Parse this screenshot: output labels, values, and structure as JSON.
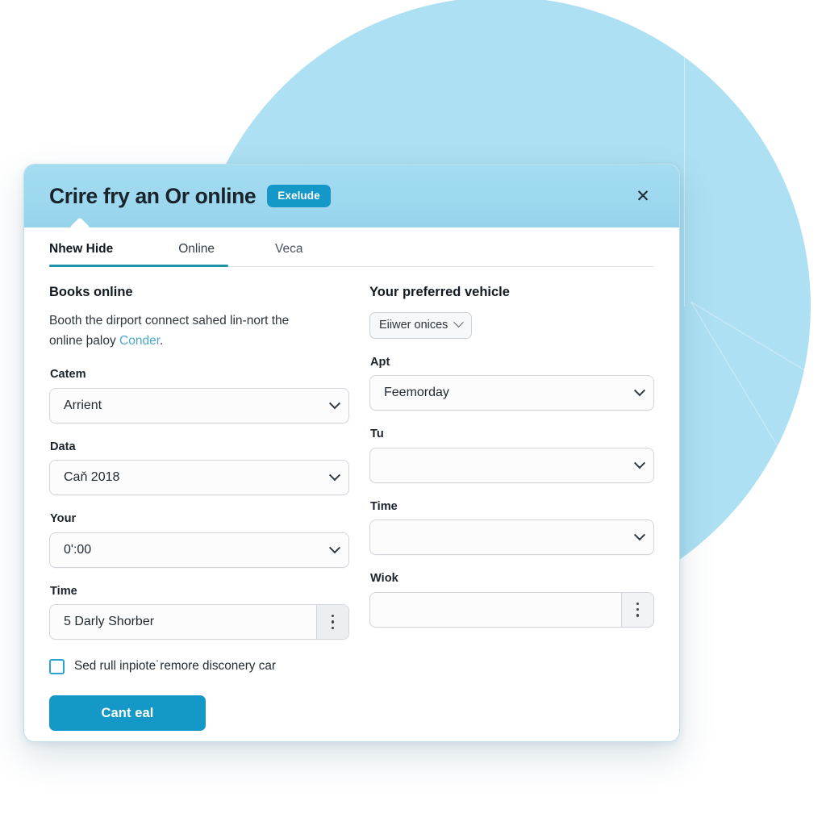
{
  "header": {
    "title": "Crire fry an Or online",
    "badge_label": "Exelude",
    "close_icon": "close-icon",
    "bg_color": "#9ed8ef",
    "badge_color": "#1398c8"
  },
  "tabs": [
    {
      "label": "Nhew Hide",
      "active": true
    },
    {
      "label": "Online",
      "active": false
    },
    {
      "label": "Veca",
      "active": false
    }
  ],
  "tabs_indicator_color": "#1f93a8",
  "left": {
    "section_title": "Books online",
    "paragraph_line1": "Booth the dirport connect sahed lin-nort",
    "paragraph_line2_prefix": "the online þaloу ",
    "paragraph_link": "Conder",
    "paragraph_suffix": ".",
    "fields": [
      {
        "label": "Catem",
        "value": "Arrient",
        "control": "select"
      },
      {
        "label": "Data",
        "value": "Caň 2018",
        "control": "select"
      },
      {
        "label": "Your",
        "value": "0':00",
        "control": "select"
      },
      {
        "label": "Time",
        "value": "5 Darly Shorber",
        "control": "kebab"
      }
    ],
    "checkbox": {
      "label": "Sed rull inpiote˙remore disconery car",
      "checked": false,
      "accent": "#2ba3cf"
    },
    "primary_button": "Cant eal"
  },
  "right": {
    "section_title": "Your preferred vehicle",
    "mini_select_value": "Eiiwer onices",
    "fields": [
      {
        "label": "Apt",
        "value": "Feemorday",
        "control": "select"
      },
      {
        "label": "Tu",
        "value": "",
        "control": "select"
      },
      {
        "label": "Time",
        "value": "",
        "control": "select"
      },
      {
        "label": "Wiok",
        "value": "",
        "control": "kebab"
      }
    ]
  }
}
